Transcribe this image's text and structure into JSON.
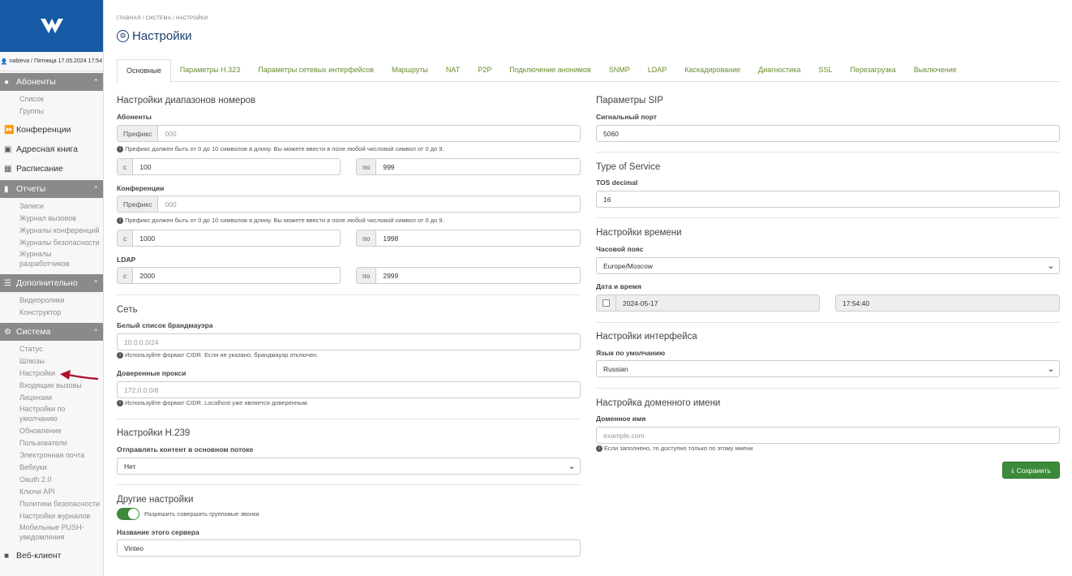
{
  "sidebar": {
    "user_line": "nabieva / Пятница 17.05.2024 17:54",
    "sections": {
      "subscribers": {
        "title": "Абоненты",
        "items": [
          "Список",
          "Группы"
        ]
      },
      "conferences": "Конференции",
      "address_book": "Адресная книга",
      "schedule": "Расписание",
      "reports": {
        "title": "Отчеты",
        "items": [
          "Записи",
          "Журнал вызовов",
          "Журналы конференций",
          "Журналы безопасности",
          "Журналы разработчиков"
        ]
      },
      "extra": {
        "title": "Дополнительно",
        "items": [
          "Видеоролики",
          "Конструктор"
        ]
      },
      "system": {
        "title": "Система",
        "items": [
          "Статус",
          "Шлюзы",
          "Настройки",
          "Входящие вызовы",
          "Лицензии",
          "Настройки по умолчанию",
          "Обновление",
          "Пользователи",
          "Электронная почта",
          "Вебхуки",
          "Oauth 2.0",
          "Ключи API",
          "Политики безопасности",
          "Настройки журналов",
          "Мобильные PUSH-уведомления"
        ]
      },
      "web_client": "Веб-клиент"
    }
  },
  "breadcrumb": "ГЛАВНАЯ / СИСТЕМА / НАСТРОЙКИ",
  "page_title": "Настройки",
  "tabs": [
    "Основные",
    "Параметры H.323",
    "Параметры сетевых интерфейсов",
    "Маршруты",
    "NAT",
    "P2P",
    "Подключение анонимов",
    "SNMP",
    "LDAP",
    "Каскадирование",
    "Диагностика",
    "SSL",
    "Перезагрузка",
    "Выключение"
  ],
  "left": {
    "ranges_title": "Настройки диапазонов номеров",
    "subscribers_label": "Абоненты",
    "prefix_addon": "Префикс",
    "prefix_placeholder": "000",
    "prefix_note": "Префикс должен быть от 0 до 10 символов в длину. Вы можете ввести в поле любой числовой символ от 0 до 9.",
    "from_addon": "с",
    "to_addon": "по",
    "subscribers_from": "100",
    "subscribers_to": "999",
    "conferences_label": "Конференции",
    "conferences_from": "1000",
    "conferences_to": "1998",
    "ldap_label": "LDAP",
    "ldap_from": "2000",
    "ldap_to": "2999",
    "network_title": "Сеть",
    "firewall_label": "Белый список брандмауэра",
    "firewall_placeholder": "10.0.0.0/24",
    "firewall_note": "Используйте формат CIDR. Если не указано, брандмауэр отключен.",
    "proxies_label": "Доверенные прокси",
    "proxies_placeholder": "172.0.0.0/8",
    "proxies_note": "Используйте формат CIDR. Localhost уже является доверенным.",
    "h239_title": "Настройки H.239",
    "h239_label": "Отправлять контент в основном потоке",
    "h239_value": "Нет",
    "other_title": "Другие настройки",
    "group_calls_label": "Разрешить совершать групповые звонки",
    "server_name_label": "Название этого сервера",
    "server_name_value": "Vinteo"
  },
  "right": {
    "sip_title": "Параметры SIP",
    "signal_port_label": "Сигнальный порт",
    "signal_port_value": "5060",
    "tos_title": "Type of Service",
    "tos_label": "TOS decimal",
    "tos_value": "16",
    "time_title": "Настройки времени",
    "timezone_label": "Часовой пояс",
    "timezone_value": "Europe/Moscow",
    "datetime_label": "Дата и время",
    "date_value": "2024-05-17",
    "time_value": "17:54:40",
    "iface_title": "Настройки интерфейса",
    "lang_label": "Язык по умолчанию",
    "lang_value": "Russian",
    "domain_title": "Настройка доменного имени",
    "domain_label": "Доменное имя",
    "domain_placeholder": "example.com",
    "domain_note": "Если заполнено, то доступно только по этому имени",
    "save_label": "Сохранить"
  },
  "colors": {
    "brand": "#165aa6",
    "accent_green": "#3c8a3a",
    "tab_link": "#6a8d2d",
    "arrow": "#b0102a"
  }
}
